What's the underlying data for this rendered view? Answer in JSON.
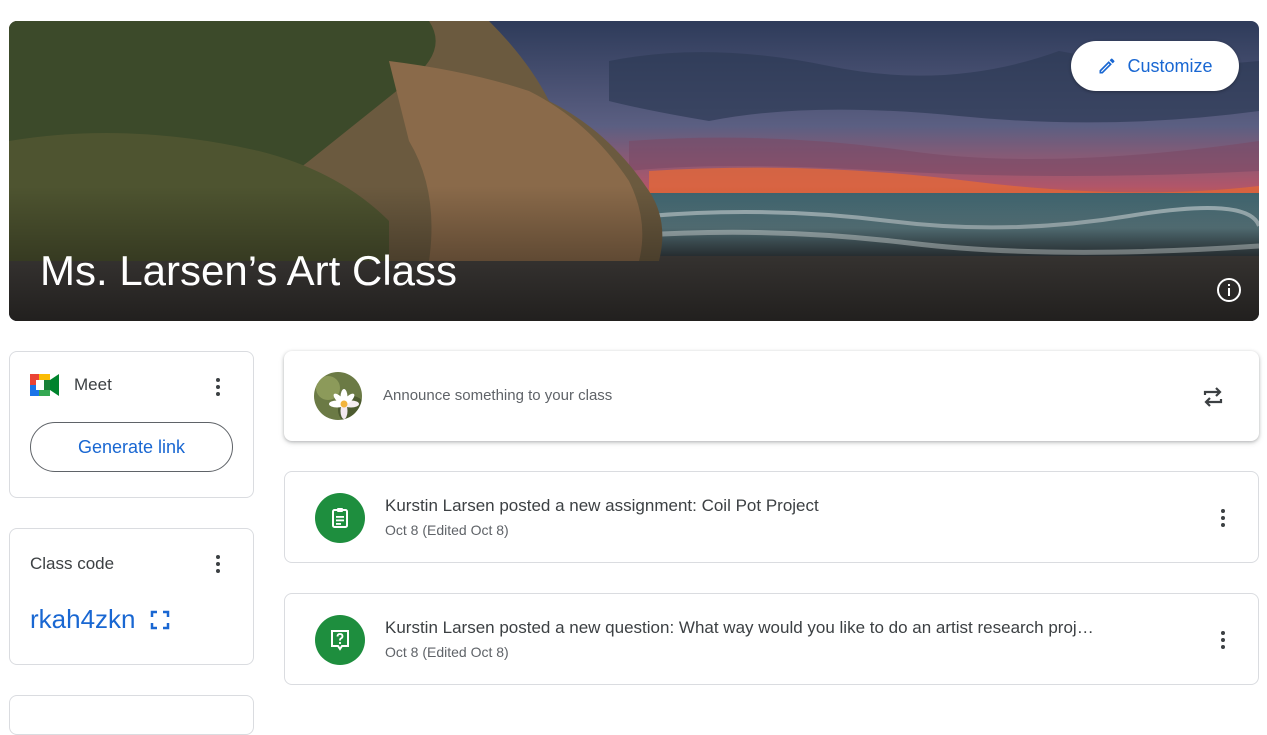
{
  "banner": {
    "title": "Ms. Larsen’s Art Class",
    "customize_label": "Customize"
  },
  "meet": {
    "label": "Meet",
    "generate_label": "Generate link"
  },
  "class_code": {
    "label": "Class code",
    "value": "rkah4zkn"
  },
  "stream": {
    "announce_placeholder": "Announce something to your class",
    "posts": [
      {
        "title": "Kurstin Larsen posted a new assignment: Coil Pot Project",
        "date": "Oct 8 (Edited Oct 8)",
        "icon": "assignment-icon"
      },
      {
        "title": "Kurstin Larsen posted a new question: What way would you like to do an artist research proj…",
        "date": "Oct 8 (Edited Oct 8)",
        "icon": "question-icon"
      }
    ]
  },
  "colors": {
    "accent": "#1967d2",
    "post_icon_bg": "#1e8e3e",
    "border": "#dadce0"
  }
}
